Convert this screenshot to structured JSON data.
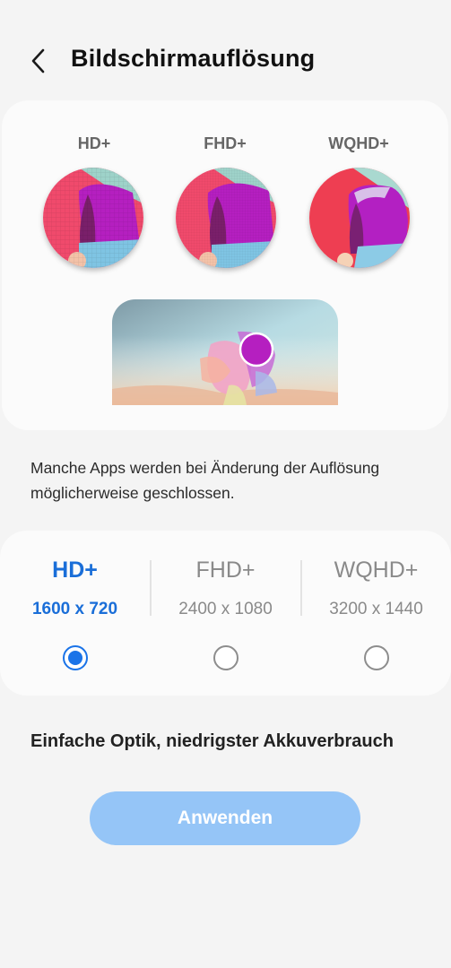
{
  "header": {
    "title": "Bildschirmauflösung",
    "back_icon": "chevron-left-icon"
  },
  "preview": {
    "labels": [
      "HD+",
      "FHD+",
      "WQHD+"
    ]
  },
  "note": "Manche Apps werden bei Änderung der Auflösung möglicherweise geschlossen.",
  "options": [
    {
      "name": "HD+",
      "resolution": "1600 x 720",
      "selected": true
    },
    {
      "name": "FHD+",
      "resolution": "2400 x 1080",
      "selected": false
    },
    {
      "name": "WQHD+",
      "resolution": "3200 x 1440",
      "selected": false
    }
  ],
  "description": "Einfache Optik, niedrigster Akkuverbrauch",
  "apply_button": {
    "label": "Anwenden",
    "enabled": false
  },
  "colors": {
    "accent": "#1a73e8",
    "button_disabled": "#95c5f7",
    "background": "#f4f4f4"
  }
}
